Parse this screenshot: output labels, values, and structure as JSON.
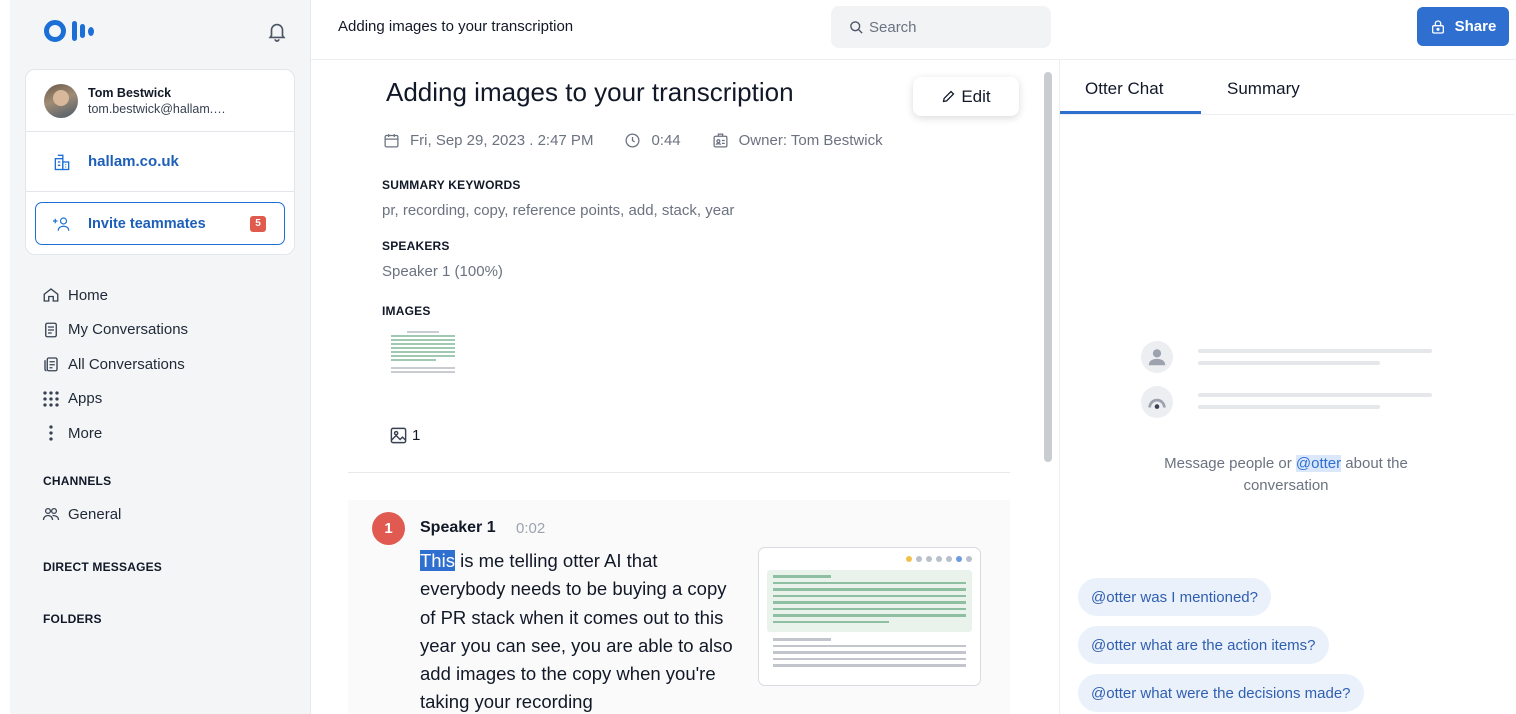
{
  "sidebar": {
    "user_name": "Tom Bestwick",
    "user_email": "tom.bestwick@hallam.…",
    "org_name": "hallam.co.uk",
    "invite_label": "Invite teammates",
    "invite_badge": "5",
    "nav": [
      {
        "label": "Home",
        "icon": "home-icon"
      },
      {
        "label": "My Conversations",
        "icon": "document-icon"
      },
      {
        "label": "All Conversations",
        "icon": "documents-icon"
      },
      {
        "label": "Apps",
        "icon": "grid-icon"
      },
      {
        "label": "More",
        "icon": "more-vertical-icon"
      }
    ],
    "channels_title": "CHANNELS",
    "channels": [
      {
        "label": "General",
        "icon": "people-icon"
      }
    ],
    "direct_messages_title": "DIRECT MESSAGES",
    "folders_title": "FOLDERS"
  },
  "topbar": {
    "title": "Adding images to your transcription",
    "search_placeholder": "Search",
    "share_label": "Share"
  },
  "conversation": {
    "title": "Adding images to your transcription",
    "edit_label": "Edit",
    "date": "Fri, Sep 29, 2023 . 2:47 PM",
    "duration": "0:44",
    "owner": "Owner: Tom Bestwick",
    "summary_keywords_title": "SUMMARY KEYWORDS",
    "keywords": "pr, recording, copy, reference points, add, stack, year",
    "speakers_title": "SPEAKERS",
    "speakers": "Speaker 1 (100%)",
    "images_title": "IMAGES",
    "image_count": "1"
  },
  "transcript": {
    "speaker_number": "1",
    "speaker_name": "Speaker 1",
    "timestamp": "0:02",
    "highlighted_word": "This",
    "text": " is me telling otter AI that everybody needs to be buying a copy of PR stack when it comes out to this year you can see, you are able to also add images to the copy when you're taking your recording"
  },
  "right_panel": {
    "tabs": [
      "Otter Chat",
      "Summary"
    ],
    "active_tab": "Otter Chat",
    "empty_message_before": "Message people or ",
    "empty_message_mention": "@otter",
    "empty_message_after": " about the conversation",
    "suggestions": [
      "@otter was I mentioned?",
      "@otter what are the action items?",
      "@otter what were the decisions made?"
    ]
  },
  "colors": {
    "accent": "#2f6fd0",
    "badge": "#e05a4e",
    "speaker": "#e15a51"
  }
}
